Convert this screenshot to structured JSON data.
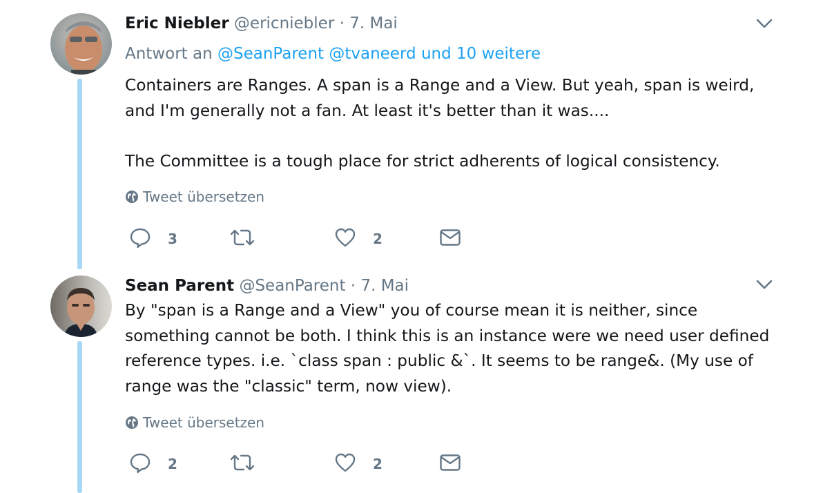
{
  "tweets": [
    {
      "name": "Eric Niebler",
      "handle": "@ericniebler",
      "separator": "·",
      "date": "7. Mai",
      "reply_prefix": "Antwort an",
      "reply_mentions": [
        "@SeanParent",
        "@tvaneerd"
      ],
      "reply_suffix": "und 10 weitere",
      "text_lines": [
        "Containers are Ranges. A span is a Range and a View. But yeah, span is weird,",
        "and I'm generally not a fan. At least it's better than it was....",
        "The Committee is a tough place for strict adherents of logical consistency."
      ],
      "translate_label": "Tweet übersetzen",
      "reply_count": "3",
      "retweet_count": "",
      "like_count": "2",
      "icons": {
        "translate": "globe-icon",
        "reply": "speech-bubble-icon",
        "retweet": "retweet-icon",
        "like": "heart-icon",
        "dm": "envelope-icon",
        "menu": "chevron-down-icon"
      }
    },
    {
      "name": "Sean Parent",
      "handle": "@SeanParent",
      "separator": "·",
      "date": "7. Mai",
      "text_lines": [
        "By \"span is a Range and a View\" you of course mean it is neither, since",
        "something cannot be both. I think this is an instance were we need user defined",
        "reference types. i.e. `class span : public &`. It seems to be range&. (My use of",
        "range was the \"classic\" term, now view)."
      ],
      "translate_label": "Tweet übersetzen",
      "reply_count": "2",
      "retweet_count": "",
      "like_count": "2",
      "icons": {
        "translate": "globe-icon",
        "reply": "speech-bubble-icon",
        "retweet": "retweet-icon",
        "like": "heart-icon",
        "dm": "envelope-icon",
        "menu": "chevron-down-icon"
      }
    }
  ],
  "colors": {
    "text": "#14171a",
    "secondary": "#657786",
    "link": "#1da1f2",
    "thread_line": "#a8d7f3",
    "icon": "#657786"
  }
}
